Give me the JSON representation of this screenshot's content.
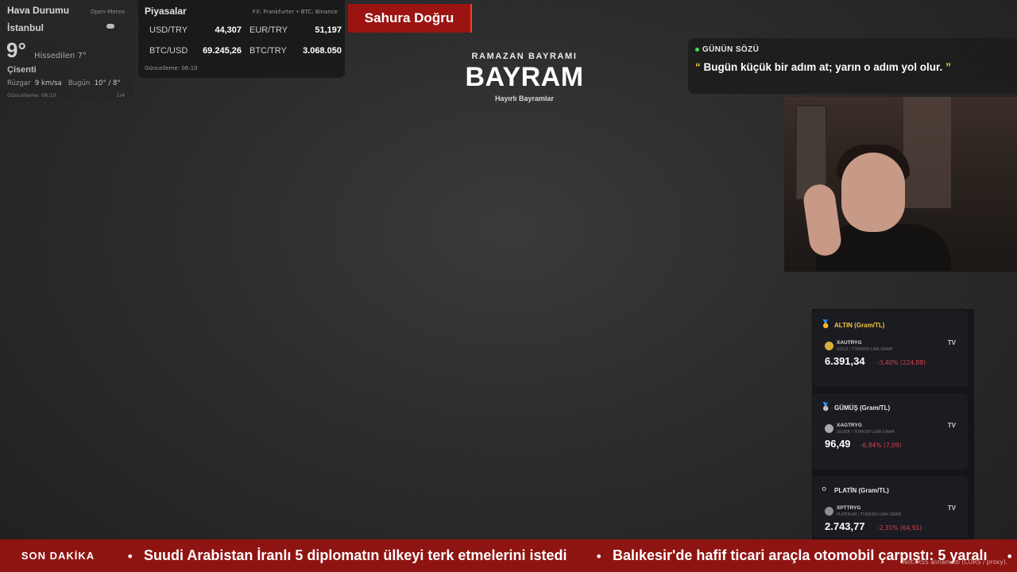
{
  "weather": {
    "title": "Hava Durumu",
    "source": "Open-Meteo",
    "city": "İstanbul",
    "temperature": "9°",
    "feels_like": "Hissedilen 7°",
    "condition": "Çisenti",
    "wind_label": "Rüzgar",
    "wind_value": "9 km/sa",
    "today_label": "Bugün",
    "today_value": "10° / 8°",
    "updated": "Güncelleme: 06:10",
    "page": "1/4",
    "icon": "cloud-icon"
  },
  "markets": {
    "title": "Piyasalar",
    "source": "FX: Frankfurter • BTC: Binance",
    "rows": [
      {
        "key": "USD/TRY",
        "value": "44,307"
      },
      {
        "key": "EUR/TRY",
        "value": "51,197"
      },
      {
        "key": "BTC/USD",
        "value": "69.245,26"
      },
      {
        "key": "BTC/TRY",
        "value": "3.068.050"
      }
    ],
    "updated": "Güncelleme: 06:10"
  },
  "countdown": {
    "label": "Sahura Doğru",
    "color": "#9b1412"
  },
  "header": {
    "subtitle": "RAMAZAN BAYRAMI",
    "title": "BAYRAM",
    "greeting": "Hayırlı Bayramlar"
  },
  "quote": {
    "label": "GÜNÜN SÖZÜ",
    "open_mark": "“",
    "text": "Bugün küçük bir adım at; yarın o adım yol olur.",
    "close_mark": "”"
  },
  "commodities": [
    {
      "header": "ALTIN (Gram/TL)",
      "header_color": "#f5c542",
      "medal": "🥇",
      "symbol": "XAUTRYG",
      "desc": "GOLD / TURKISH LIRA GRAM",
      "price": "6.391,34",
      "change": "-3,40% (224,88)",
      "coin_color": "#d9b23a",
      "tv": "TV"
    },
    {
      "header": "GÜMÜŞ (Gram/TL)",
      "header_color": "#e6e6e6",
      "medal": "🥈",
      "symbol": "XAGTRYG",
      "desc": "SILVER / TURKISH LIRA GRAM",
      "price": "96,49",
      "change": "-6,84% (7,09)",
      "coin_color": "#a8a8b0",
      "tv": "TV"
    },
    {
      "header": "PLATİN (Gram/TL)",
      "header_color": "#e6e6e6",
      "medal": "⚪",
      "symbol": "XPTTRYG",
      "desc": "PLATINUM / TURKISH LIRA GRAM",
      "price": "2.743,77",
      "change": "-2,31% (64,91)",
      "coin_color": "#8d8d94",
      "tv": "TV"
    }
  ],
  "ticker": {
    "label": "SON DAKİKA",
    "items": [
      "Suudi Arabistan İranlı 5 diplomatın ülkeyi terk etmelerini istedi",
      "Balıkesir'de hafif ticari araçla otomobil çarpıştı: 5 yaralı"
    ],
    "note": "Not: RSS alınamadı (CORS / proxy)."
  }
}
